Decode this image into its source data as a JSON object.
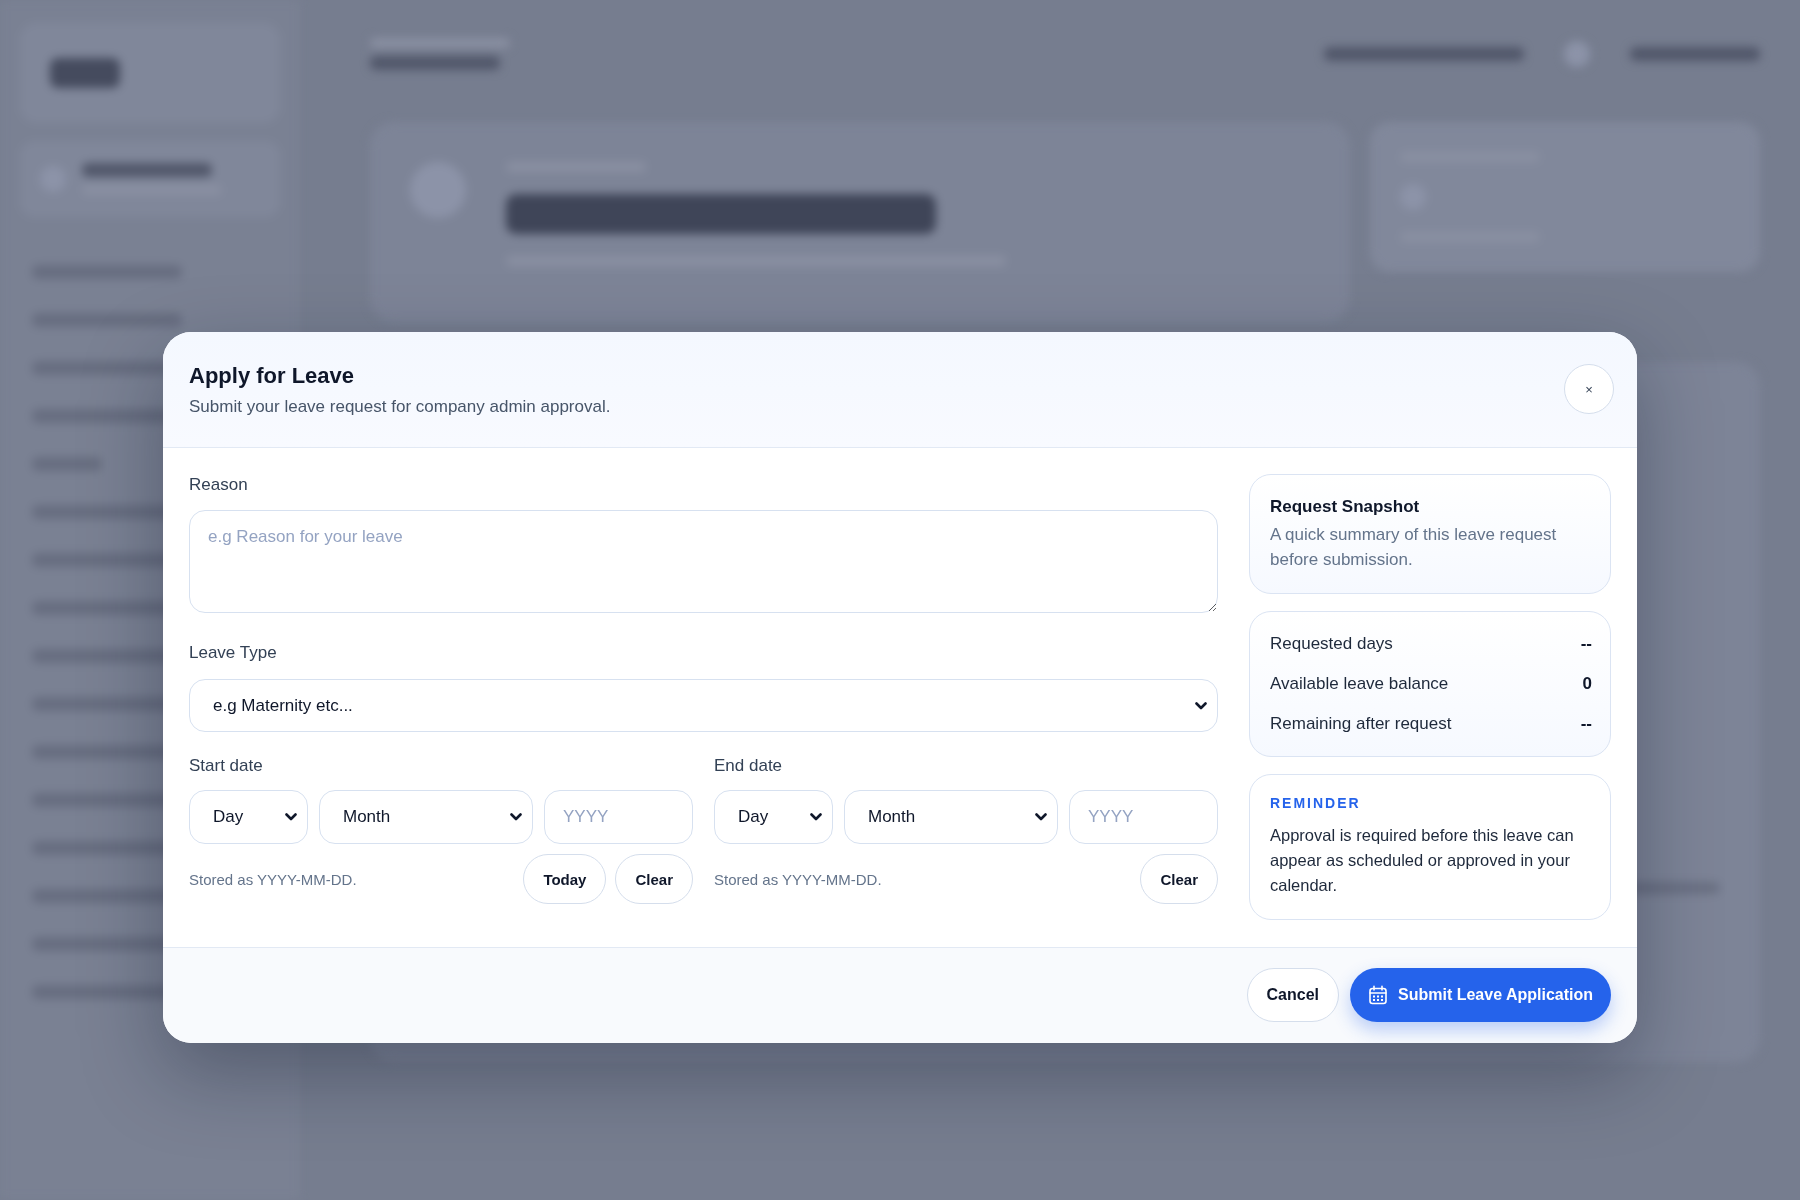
{
  "dialog": {
    "title": "Apply for Leave",
    "subtitle": "Submit your leave request for company admin approval.",
    "close": "×"
  },
  "form": {
    "reason": {
      "label": "Reason",
      "placeholder": "e.g Reason for your leave"
    },
    "leave_type": {
      "label": "Leave Type",
      "value": "e.g Maternity etc..."
    },
    "dates": [
      {
        "label": "Start date",
        "day": {
          "value": "Day"
        },
        "month": {
          "value": "Month"
        },
        "year": {
          "placeholder": "YYYY"
        },
        "hint": "Stored as YYYY-MM-DD.",
        "buttons": [
          "Today",
          "Clear"
        ]
      },
      {
        "label": "End date",
        "day": {
          "value": "Day"
        },
        "month": {
          "value": "Month"
        },
        "year": {
          "placeholder": "YYYY"
        },
        "hint": "Stored as YYYY-MM-DD.",
        "buttons": [
          "Clear"
        ]
      }
    ]
  },
  "snapshot": {
    "title": "Request Snapshot",
    "description": "A quick summary of this leave request before submission."
  },
  "summary": {
    "rows": [
      {
        "label": "Requested days",
        "value": "--"
      },
      {
        "label": "Available leave balance",
        "value": "0"
      },
      {
        "label": "Remaining after request",
        "value": "--"
      }
    ]
  },
  "reminder": {
    "heading": "REMINDER",
    "text": "Approval is required before this leave can appear as scheduled or approved in your calendar."
  },
  "footer": {
    "buttons": [
      {
        "label": "Cancel",
        "kind": "secondary"
      },
      {
        "label": "Submit Leave Application",
        "kind": "primary"
      }
    ]
  }
}
